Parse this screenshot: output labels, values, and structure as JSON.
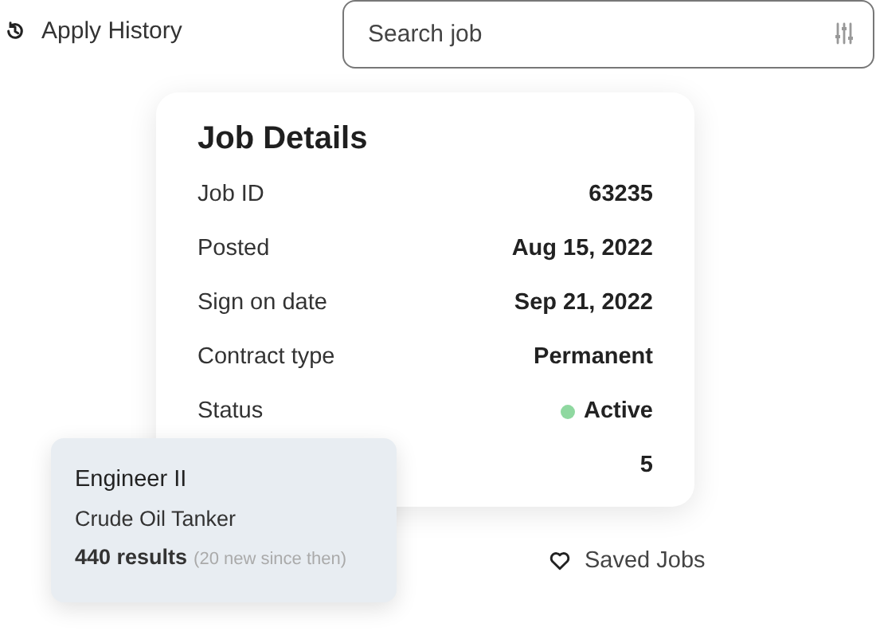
{
  "history_link": {
    "label": "Apply History"
  },
  "search": {
    "placeholder": "Search job"
  },
  "job_details": {
    "title": "Job Details",
    "rows": [
      {
        "label": "Job ID",
        "value": "63235"
      },
      {
        "label": "Posted",
        "value": "Aug 15, 2022"
      },
      {
        "label": "Sign on date",
        "value": "Sep 21, 2022"
      },
      {
        "label": "Contract type",
        "value": "Permanent"
      },
      {
        "label": "Status",
        "value": "Active",
        "color": "#8fd8a0"
      },
      {
        "value": "5"
      }
    ]
  },
  "saved_search": {
    "title": "Engineer II",
    "subtitle": "Crude Oil Tanker",
    "results": "440 results",
    "note": "(20 new since then)"
  },
  "saved_jobs": {
    "label": "Saved Jobs"
  }
}
